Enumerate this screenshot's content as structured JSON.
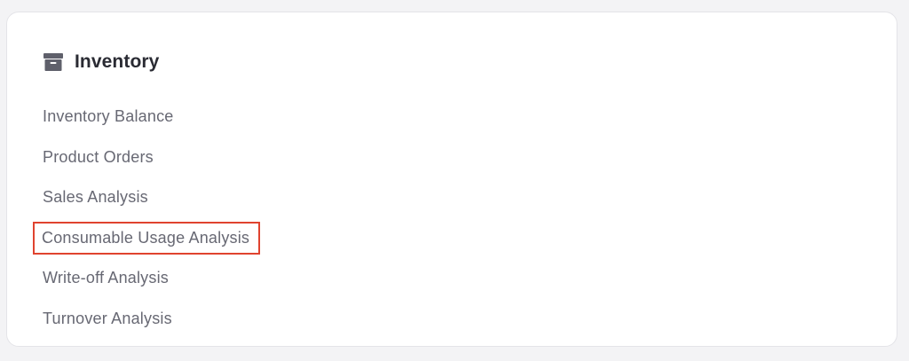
{
  "section": {
    "icon": "archive-box-icon",
    "title": "Inventory"
  },
  "menu": {
    "items": [
      {
        "label": "Inventory Balance"
      },
      {
        "label": "Product Orders"
      },
      {
        "label": "Sales Analysis"
      },
      {
        "label": "Consumable Usage Analysis",
        "highlighted": true
      },
      {
        "label": "Write-off Analysis"
      },
      {
        "label": "Turnover Analysis"
      }
    ]
  },
  "colors": {
    "background": "#f3f3f5",
    "card": "#ffffff",
    "title_text": "#2a2b33",
    "item_text": "#676873",
    "icon": "#5f606b",
    "highlight_border": "#e0432f"
  }
}
